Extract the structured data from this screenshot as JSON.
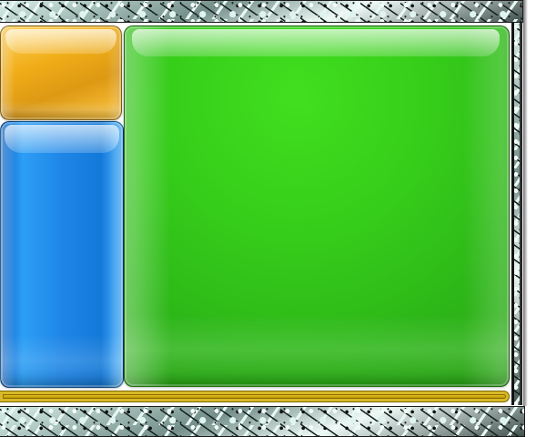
{
  "scene": {
    "type": "sliding-block puzzle"
  },
  "colors": {
    "orange_piece": "#F0AD18",
    "blue_piece": "#1F86E7",
    "green_piece": "#36CD1A",
    "gold_bar": "#E7C21A",
    "stone_border": "#748F8A"
  },
  "blocks": [
    {
      "name": "orange-block",
      "color": "#F0AD18"
    },
    {
      "name": "blue-block",
      "color": "#1F86E7"
    },
    {
      "name": "green-block",
      "color": "#36CD1A"
    }
  ]
}
